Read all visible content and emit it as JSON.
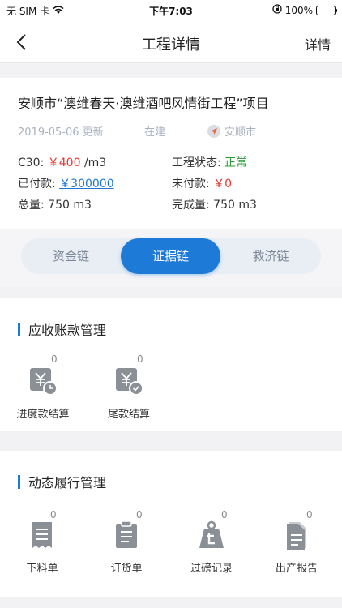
{
  "status_bar": {
    "carrier": "无 SIM 卡",
    "time": "下午7:03",
    "battery": "100%",
    "battery_level": 1.0
  },
  "nav": {
    "title": "工程详情",
    "right_label": "详情"
  },
  "project": {
    "title": "安顺市“澳维春天·澳维酒吧风情街工程”项目",
    "date": "2019-05-06 更新",
    "state": "在建",
    "location": "安顺市",
    "c30_label": "C30:",
    "c30_price": "￥400",
    "c30_unit": "/m3",
    "status_label": "工程状态:",
    "status_value": "正常",
    "paid_label": "已付款:",
    "paid_value": "￥300000",
    "unpaid_label": "未付款:",
    "unpaid_value": "￥0",
    "total_label": "总量:",
    "total_value": "750 m3",
    "done_label": "完成量:",
    "done_value": "750 m3"
  },
  "segments": [
    {
      "label": "资金链",
      "active": false
    },
    {
      "label": "证据链",
      "active": true
    },
    {
      "label": "救济链",
      "active": false
    }
  ],
  "receivables": {
    "title": "应收账款管理",
    "items": [
      {
        "label": "进度款结算",
        "count": "0",
        "icon": "yen-clock-icon"
      },
      {
        "label": "尾款结算",
        "count": "0",
        "icon": "yen-check-icon"
      }
    ]
  },
  "performance": {
    "title": "动态履行管理",
    "items": [
      {
        "label": "下料单",
        "count": "0",
        "icon": "receipt-icon"
      },
      {
        "label": "订货单",
        "count": "0",
        "icon": "clipboard-icon"
      },
      {
        "label": "过磅记录",
        "count": "0",
        "icon": "scale-icon"
      },
      {
        "label": "出产报告",
        "count": "0",
        "icon": "document-icon"
      }
    ]
  },
  "colors": {
    "accent": "#1d7ad6",
    "price_red": "#e53935",
    "status_green": "#2a9d3a",
    "icon_gray": "#8b8f96"
  }
}
